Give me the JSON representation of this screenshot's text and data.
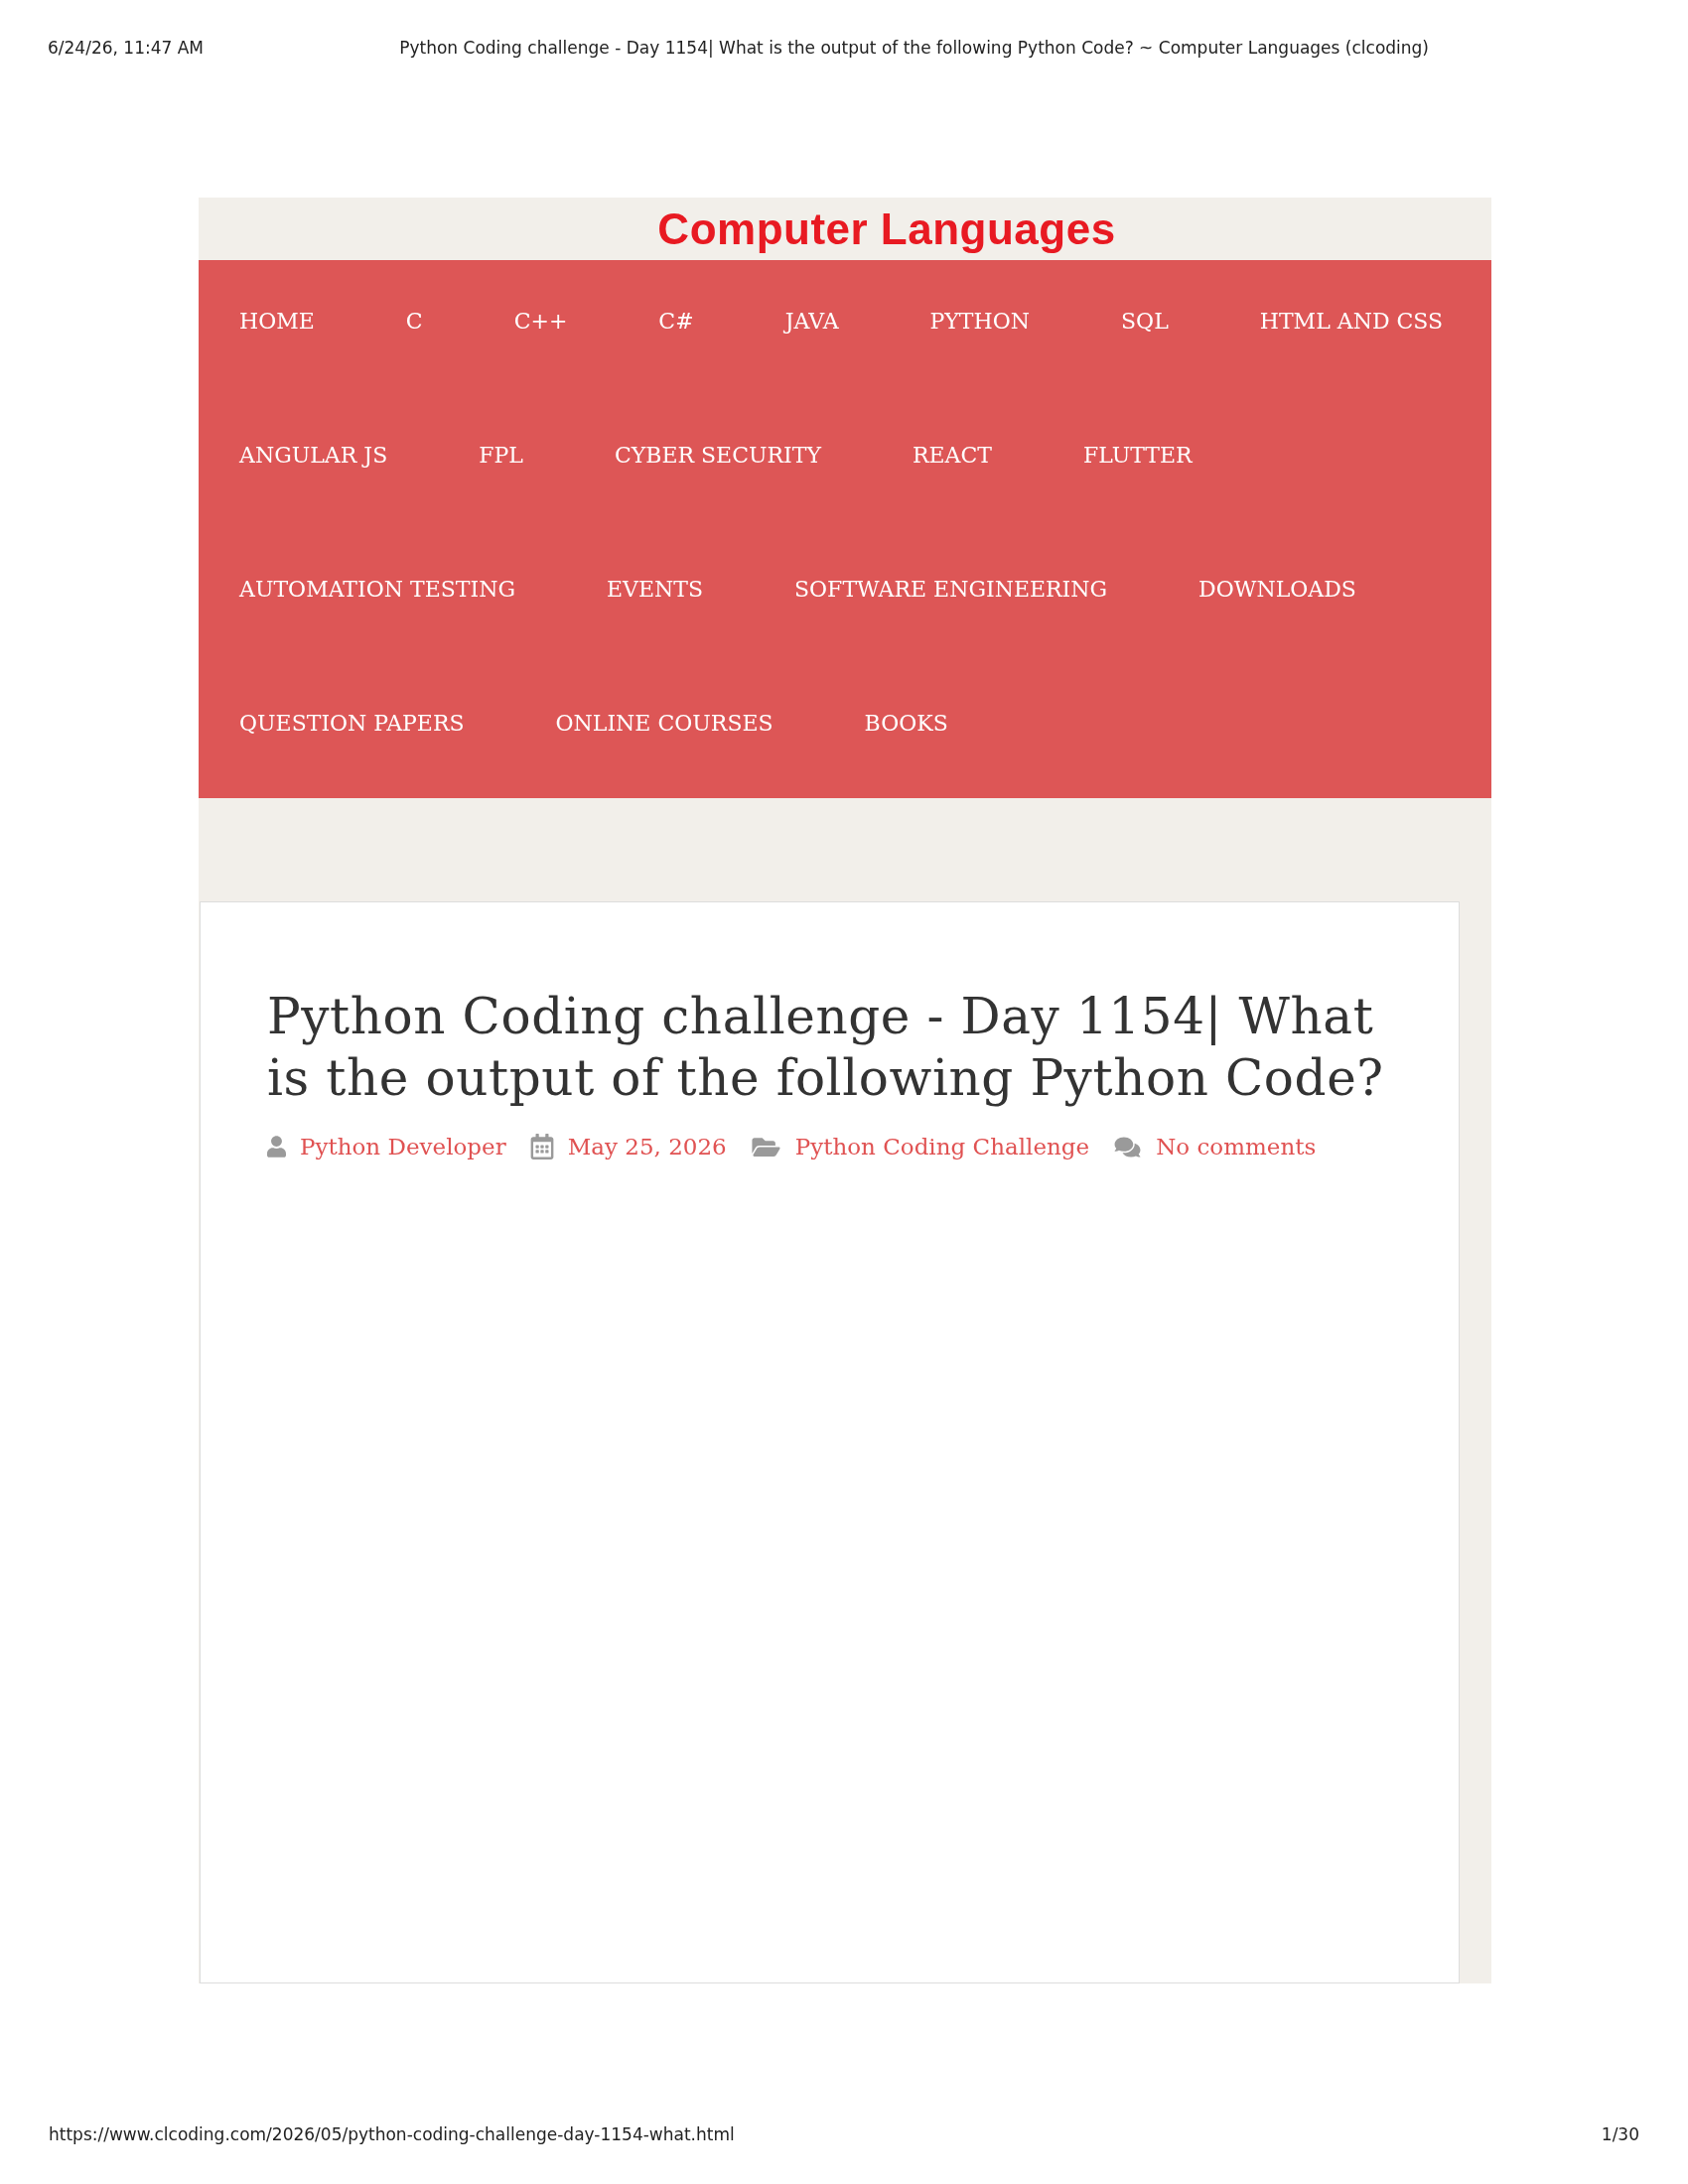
{
  "print_header": {
    "date": "6/24/26, 11:47 AM",
    "title": "Python Coding challenge - Day 1154| What is the output of the following Python Code? ~ Computer Languages (clcoding)"
  },
  "site": {
    "logo": "Computer Languages"
  },
  "nav": {
    "items": [
      "HOME",
      "C",
      "C++",
      "C#",
      "JAVA",
      "PYTHON",
      "SQL",
      "HTML AND CSS",
      "ANGULAR JS",
      "FPL",
      "CYBER SECURITY",
      "REACT",
      "FLUTTER",
      "AUTOMATION TESTING",
      "EVENTS",
      "SOFTWARE ENGINEERING",
      "DOWNLOADS",
      "QUESTION PAPERS",
      "ONLINE COURSES",
      "BOOKS"
    ]
  },
  "post": {
    "title": "Python Coding challenge - Day 1154| What is the output of the following Python Code?",
    "meta": [
      {
        "kind": "author",
        "text": "Python Developer"
      },
      {
        "kind": "date",
        "text": "May 25, 2026"
      },
      {
        "kind": "category",
        "text": "Python Coding Challenge"
      },
      {
        "kind": "comments",
        "text": "No comments"
      }
    ]
  },
  "print_footer": {
    "url": "https://www.clcoding.com/2026/05/python-coding-challenge-day-1154-what.html",
    "page": "1/30"
  }
}
